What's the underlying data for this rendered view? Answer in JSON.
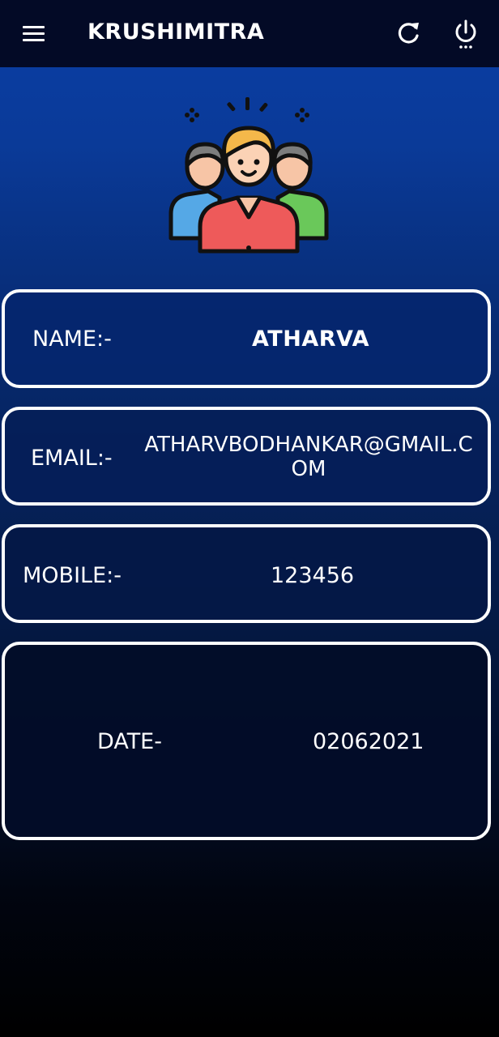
{
  "app_bar": {
    "title": "KRUSHIMITRA",
    "menu_icon": "hamburger-menu-icon",
    "refresh_icon": "refresh-icon",
    "power_icon": "power-icon"
  },
  "hero": {
    "icon": "user-group-icon"
  },
  "profile": {
    "name": {
      "label": "NAME:-",
      "value": "ATHARVA"
    },
    "email": {
      "label": "EMAIL:-",
      "value": "ATHARVBODHANKAR@GMAIL.COM"
    },
    "mobile": {
      "label": "MOBILE:-",
      "value": "123456"
    },
    "date": {
      "label": "DATE-",
      "value": "02062021"
    }
  },
  "colors": {
    "app_bar_bg": "#030a26",
    "accent_blue": "#0a3ea6",
    "card_border": "#ffffff",
    "text": "#ffffff"
  }
}
